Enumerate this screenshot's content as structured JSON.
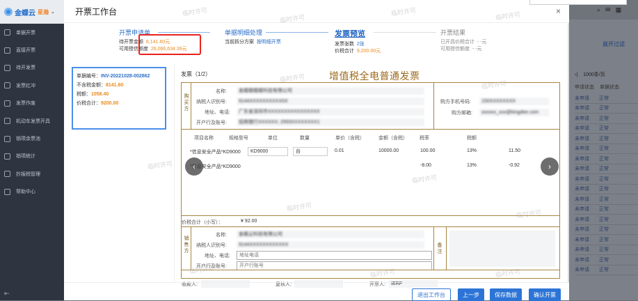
{
  "nav": {
    "brand": "金蝶云",
    "brand_sub": "星瀚",
    "items": [
      "单据开票",
      "直接开票",
      "待开发票",
      "发票红冲",
      "发票作废",
      "机动车发票开具",
      "销项余票池",
      "销项统计",
      "抄报税管理",
      "帮助中心"
    ],
    "bottom_icon": "menu-collapse-icon"
  },
  "modal": {
    "title": "开票工作台",
    "close": "×",
    "steps": {
      "s1": {
        "title": "开票申请单",
        "l1": "待开票金额",
        "v1": "8,141.60元",
        "l2": "可用授信额度",
        "v2": "26,066,634.39元"
      },
      "s2": {
        "title": "单据明细处理",
        "l1": "当前拆分方案",
        "v1": "按明细开票"
      },
      "s3": {
        "title": "发票预览",
        "l1": "发票张数",
        "v1": "2张",
        "l2": "价税合计",
        "v2": "9,200.00元"
      },
      "s4": {
        "title": "开票结果",
        "l1": "已开具价税合计",
        "v1": "- -元",
        "l2": "可用授信额度",
        "v2": "- -元"
      }
    },
    "summary": {
      "no_label": "单据编号：",
      "no": "INV-20221028-002862",
      "amount_label": "不含税金额：",
      "amount": "8141.60",
      "tax_label": "税额：",
      "tax": "1058.40",
      "total_label": "价税合计：",
      "total": "9200.00"
    },
    "invoice": {
      "label": "发票（1/2）",
      "title": "增值税全电普通发票",
      "buyer_head": "购买方",
      "seller_head": "销售方",
      "remark_head": "备注",
      "buyer": {
        "name_l": "名称:",
        "name": "金蝶蝶蝶蝶科技有限公司",
        "tax_l": "纳税人识别号:",
        "tax": "9144XXXXXXXXXX0X",
        "addr_l": "地址、电话:",
        "addr": "广东省深圳市XXXXXXXXXXXXXXXX",
        "bank_l": "开户行及账号:",
        "bank": "招商银行XXXXXX; 2993XXXXXXXX1",
        "phone_l": "购方手机号码:",
        "phone": "150XXXXXXXX",
        "email_l": "购方邮箱:",
        "email": "xxxxxx_xxx@kingdee.com"
      },
      "columns": [
        "项目名称",
        "规格型号",
        "单位",
        "数量",
        "单价（含税）",
        "金额（含税）",
        "税率",
        "税额"
      ],
      "rows": [
        {
          "name": "*信息安全产品*KD9000",
          "spec": "KD9000",
          "unit": "台",
          "qty": "0.01",
          "price": "10000.00",
          "amount": "100.00",
          "rate": "13%",
          "tax": "11.50"
        },
        {
          "name": "*信息安全产品*KD9000",
          "spec": "",
          "unit": "",
          "qty": "",
          "price": "",
          "amount": "-8.00",
          "rate": "13%",
          "tax": "-0.92"
        }
      ],
      "total_label": "价税合计（小写）：",
      "total": "¥ 92.00",
      "seller": {
        "name_l": "名称:",
        "name": "金蝶云科技有限公司",
        "tax_l": "纳税人识别号:",
        "tax": "9144XXXXXXXXXXXX",
        "addr_l": "地址、电话:",
        "addr_ph": "地址电话",
        "bank_l": "开户行及账号:",
        "bank_ph": "开户行账号"
      },
      "payee_l": "收款人:",
      "reviewer_l": "复核人:",
      "issuer_l": "开票人:",
      "issuer": "IERP"
    },
    "buttons": {
      "exit": "退出工作台",
      "prev": "上一步",
      "save": "保存数据",
      "confirm": "确认开票"
    },
    "watermark": "临时许可"
  },
  "background": {
    "tab": "展开过滤",
    "pager": "1000条/页",
    "col1": "申请状态",
    "col2": "单据状态",
    "rows": [
      [
        "未申请",
        "正常"
      ],
      [
        "未申请",
        "正常"
      ],
      [
        "未申请",
        "正常"
      ],
      [
        "未申请",
        "正常"
      ],
      [
        "未申请",
        "正常"
      ],
      [
        "未申请",
        "正常"
      ],
      [
        "未申请",
        "正常"
      ],
      [
        "未申请",
        "正常"
      ],
      [
        "未申请",
        "正常"
      ],
      [
        "未申请",
        "正常"
      ],
      [
        "未申请",
        "正常"
      ],
      [
        "未申请",
        "正常"
      ],
      [
        "未申请",
        "正常"
      ],
      [
        "未申请",
        "正常"
      ],
      [
        "未申请",
        "正常"
      ],
      [
        "未申请",
        "正常"
      ],
      [
        "未申请",
        "正常"
      ],
      [
        "未申请",
        "正常"
      ]
    ]
  }
}
